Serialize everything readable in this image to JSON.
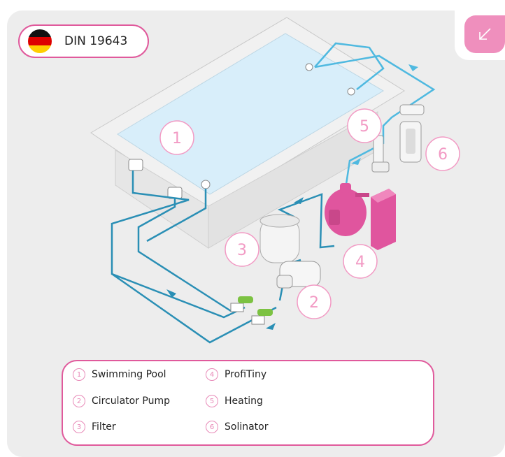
{
  "header": {
    "title": "DIN 19643",
    "flag": "germany-flag"
  },
  "corner_button": {
    "icon": "arrow-down-left-icon"
  },
  "markers": {
    "pool": "1",
    "pump": "2",
    "filter": "3",
    "profitiny": "4",
    "heating": "5",
    "solinator": "6"
  },
  "legend": {
    "items": [
      {
        "num": "1",
        "label": "Swimming Pool"
      },
      {
        "num": "2",
        "label": "Circulator Pump"
      },
      {
        "num": "3",
        "label": "Filter"
      },
      {
        "num": "4",
        "label": "ProfiTiny"
      },
      {
        "num": "5",
        "label": "Heating"
      },
      {
        "num": "6",
        "label": "Solinator"
      }
    ]
  },
  "colors": {
    "accent_pink": "#e05a9c",
    "marker_pink": "#f29ac4",
    "pipe_blue": "#2a8fb5",
    "pipe_light_blue": "#4fb9e0",
    "water": "#d8eefa",
    "valve_green": "#7cc242",
    "unit_magenta": "#e0559e"
  }
}
